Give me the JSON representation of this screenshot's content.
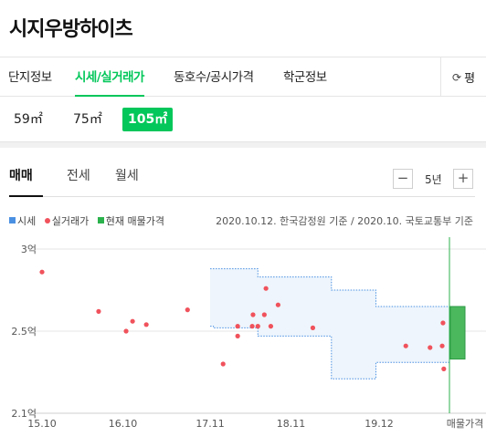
{
  "title": "시지우방하이츠",
  "tabs": [
    {
      "label": "단지정보",
      "active": false
    },
    {
      "label": "시세/실거래가",
      "active": true
    },
    {
      "label": "동호수/공시가격",
      "active": false
    },
    {
      "label": "학군정보",
      "active": false
    }
  ],
  "refresh_label": "평",
  "sizes": [
    {
      "label": "59㎡",
      "active": false
    },
    {
      "label": "75㎡",
      "active": false
    },
    {
      "label": "105㎡",
      "active": true
    }
  ],
  "price_tabs": [
    {
      "label": "매매",
      "active": true
    },
    {
      "label": "전세",
      "active": false
    },
    {
      "label": "월세",
      "active": false
    }
  ],
  "period": {
    "minus": "−",
    "value": "5년",
    "plus": "+"
  },
  "legend": [
    {
      "label": "시세",
      "color": "#4a90e2",
      "shape": "square"
    },
    {
      "label": "실거래가",
      "color": "#f0525c",
      "shape": "dot"
    },
    {
      "label": "현재 매물가격",
      "color": "#2bb24c",
      "shape": "square"
    }
  ],
  "source": "2020.10.12. 한국감정원 기준 / 2020.10. 국토교통부 기준",
  "chart_data": {
    "type": "scatter",
    "y_tick_labels": [
      "3억",
      "2.5억",
      "2.1억"
    ],
    "y_ticks": [
      3.0,
      2.5,
      2.0
    ],
    "ylim": [
      2.0,
      3.0
    ],
    "x_tick_labels": [
      "15.10",
      "16.10",
      "17.11",
      "18.11",
      "19.12",
      "매물가격"
    ],
    "x_ticks": [
      2015.75,
      2016.75,
      2017.83,
      2018.83,
      2019.92
    ],
    "xlim": [
      2015.75,
      2020.79
    ],
    "trades": [
      [
        2015.75,
        2.86
      ],
      [
        2016.45,
        2.62
      ],
      [
        2016.79,
        2.5
      ],
      [
        2016.87,
        2.56
      ],
      [
        2017.04,
        2.54
      ],
      [
        2017.55,
        2.63
      ],
      [
        2017.99,
        2.3
      ],
      [
        2018.17,
        2.47
      ],
      [
        2018.17,
        2.53
      ],
      [
        2018.35,
        2.53
      ],
      [
        2018.36,
        2.6
      ],
      [
        2018.42,
        2.53
      ],
      [
        2018.5,
        2.6
      ],
      [
        2018.52,
        2.76
      ],
      [
        2018.58,
        2.53
      ],
      [
        2018.67,
        2.66
      ],
      [
        2019.1,
        2.52
      ],
      [
        2020.25,
        2.41
      ],
      [
        2020.55,
        2.4
      ],
      [
        2020.7,
        2.41
      ],
      [
        2020.71,
        2.55
      ],
      [
        2020.72,
        2.27
      ]
    ],
    "market_range": {
      "x": [
        2017.83,
        2017.87,
        2018.33,
        2018.42,
        2019.17,
        2019.33,
        2019.53,
        2019.88,
        2020.79
      ],
      "upper": [
        2.88,
        2.88,
        2.88,
        2.83,
        2.83,
        2.75,
        2.75,
        2.65,
        2.65
      ],
      "lower": [
        2.53,
        2.52,
        2.52,
        2.47,
        2.47,
        2.21,
        2.21,
        2.31,
        2.31
      ]
    },
    "current_listing": {
      "low": 2.33,
      "high": 2.65
    }
  }
}
